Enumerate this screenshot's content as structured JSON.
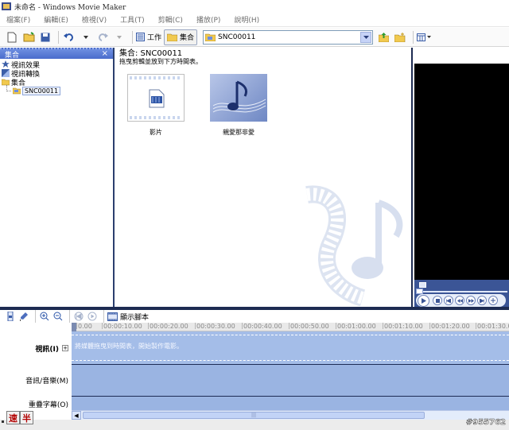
{
  "window": {
    "title": "未命名 - Windows Movie Maker"
  },
  "menu": [
    "檔案(F)",
    "編輯(E)",
    "檢視(V)",
    "工具(T)",
    "剪輯(C)",
    "播放(P)",
    "說明(H)"
  ],
  "toolbar": {
    "tasks_label": "工作",
    "collections_label": "集合",
    "collection_combo_value": "SNC00011"
  },
  "left_pane": {
    "header": "集合",
    "close_glyph": "×",
    "tree": [
      {
        "label": "視訊效果",
        "icon": "star-icon"
      },
      {
        "label": "視訊轉換",
        "icon": "transition-icon"
      },
      {
        "label": "集合",
        "icon": "folder-icon"
      }
    ],
    "selected_child": "SNC00011"
  },
  "main_pane": {
    "title": "集合: SNC00011",
    "instruction": "拖曳剪輯並放到下方時間表。",
    "items": [
      {
        "label": "影片",
        "icon": "video-file-icon"
      },
      {
        "label": "親愛那非愛",
        "icon": "music-file-icon"
      }
    ]
  },
  "timeline": {
    "show_storyboard_label": "顯示腳本",
    "ruler_ticks": [
      "0.00",
      "00:00:10.00",
      "00:00:20.00",
      "00:00:30.00",
      "00:00:40.00",
      "00:00:50.00",
      "00:01:00.00",
      "00:01:10.00",
      "00:01:20.00",
      "00:01:30.0"
    ],
    "tracks": {
      "video_label": "視訊(I)",
      "video_hint": "將媒體拖曳到時間表，開始製作電影。",
      "audio_label": "音訊/音樂(M)",
      "overlay_label": "重疊字幕(O)"
    }
  },
  "ime": {
    "key1": "速",
    "key2": "半"
  },
  "watermark_id": "#955762"
}
